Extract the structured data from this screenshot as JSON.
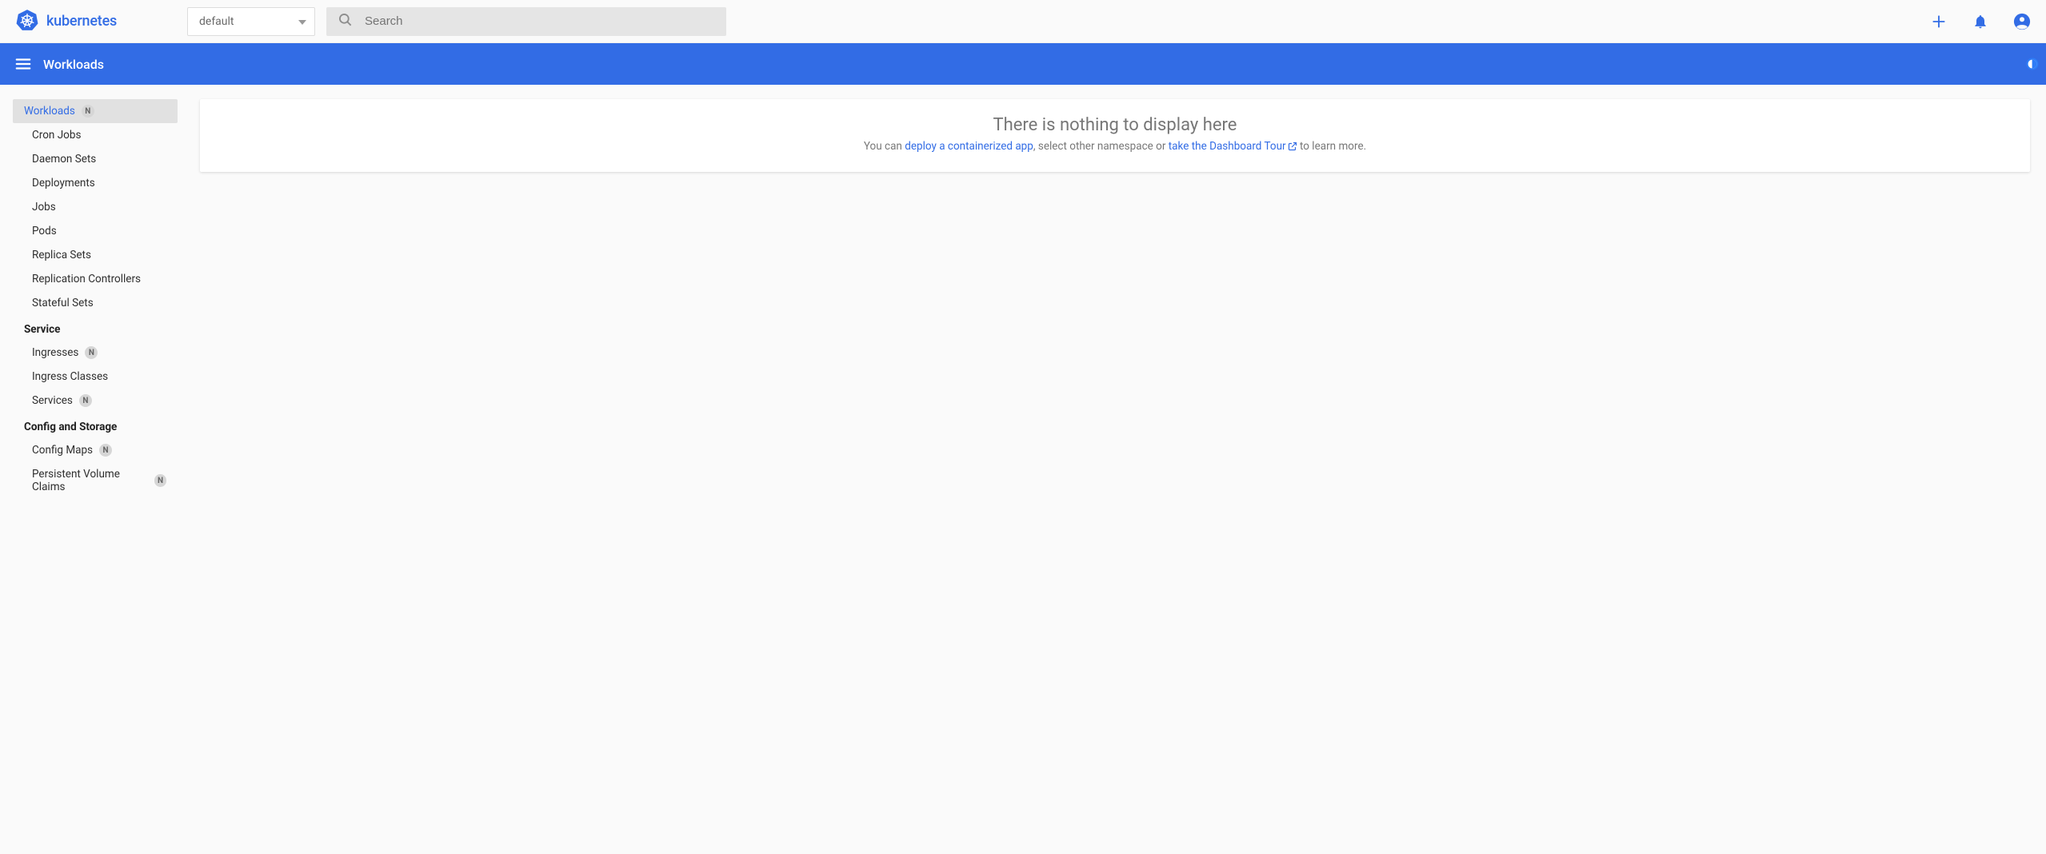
{
  "brand": {
    "name": "kubernetes"
  },
  "header": {
    "namespace": "default",
    "search_placeholder": "Search"
  },
  "breadcrumb": {
    "title": "Workloads"
  },
  "sidebar": {
    "workloads": {
      "label": "Workloads",
      "badge": "N",
      "items": [
        {
          "label": "Cron Jobs"
        },
        {
          "label": "Daemon Sets"
        },
        {
          "label": "Deployments"
        },
        {
          "label": "Jobs"
        },
        {
          "label": "Pods"
        },
        {
          "label": "Replica Sets"
        },
        {
          "label": "Replication Controllers"
        },
        {
          "label": "Stateful Sets"
        }
      ]
    },
    "service": {
      "label": "Service",
      "items": [
        {
          "label": "Ingresses",
          "badge": "N"
        },
        {
          "label": "Ingress Classes"
        },
        {
          "label": "Services",
          "badge": "N"
        }
      ]
    },
    "config": {
      "label": "Config and Storage",
      "items": [
        {
          "label": "Config Maps",
          "badge": "N"
        },
        {
          "label": "Persistent Volume Claims",
          "badge": "N"
        }
      ]
    }
  },
  "empty": {
    "title": "There is nothing to display here",
    "pre": "You can ",
    "link1": "deploy a containerized app",
    "mid": ", select other namespace or ",
    "link2": "take the Dashboard Tour",
    "post": " to learn more."
  }
}
